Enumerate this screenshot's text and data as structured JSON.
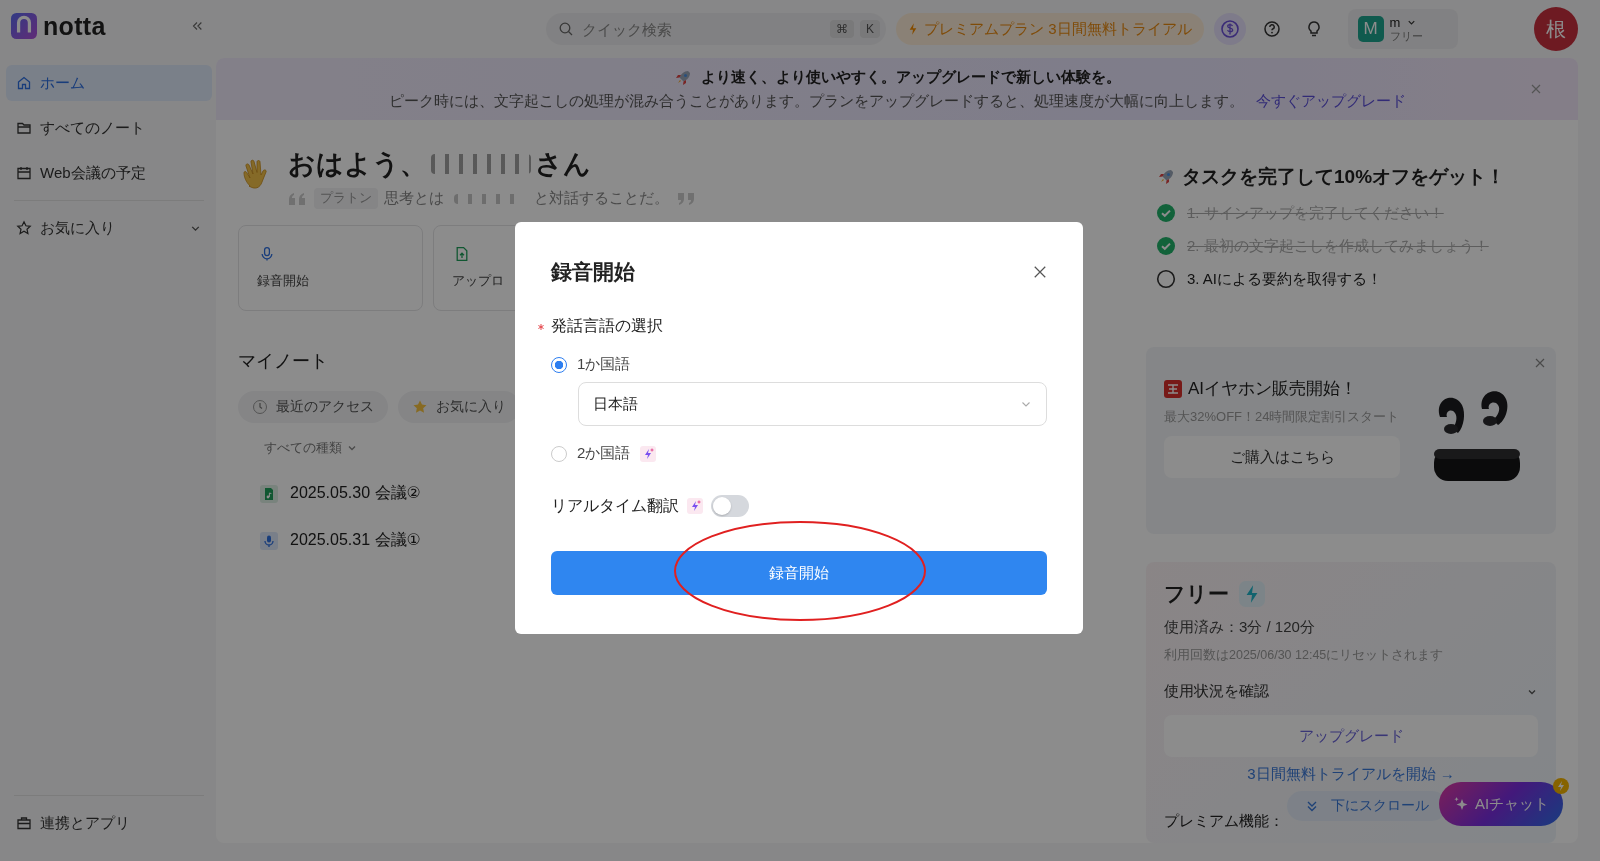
{
  "sidebar": {
    "logo": "notta",
    "items": [
      {
        "label": "ホーム",
        "kind": "home",
        "selected": true
      },
      {
        "label": "すべてのノート",
        "kind": "folder",
        "selected": false
      },
      {
        "label": "Web会議の予定",
        "kind": "calendar",
        "selected": false
      }
    ],
    "favorites": {
      "label": "お気に入り",
      "expanded": false
    },
    "bottom_item": "連携とアプリ"
  },
  "topbar": {
    "search": {
      "placeholder": "クイック検索",
      "keys": [
        "⌘",
        "K"
      ]
    },
    "premium_button": "プレミアムプラン 3日間無料トライアル",
    "account": {
      "avatar": "M",
      "name": "m",
      "plan": "フリー"
    },
    "user_avatar": "根"
  },
  "banner": {
    "headline": "より速く、より使いやすく。アップグレードで新しい体験を。",
    "message": "ピーク時には、文字起こしの処理が混み合うことがあります。プランをアップグレードすると、処理速度が大幅に向上します。",
    "link": "今すぐアップグレード"
  },
  "greeting": {
    "text": "おはよう、",
    "suffix": "さん",
    "quote_author": "プラトン",
    "quote_start": "思考とは",
    "quote_end": "と対話することだ。"
  },
  "actions": [
    {
      "label": "録音開始",
      "kind": "record"
    },
    {
      "label": "アップロ",
      "kind": "upload"
    }
  ],
  "notes": {
    "title": "マイノート",
    "filters": [
      {
        "label": "最近のアクセス",
        "kind": "recent"
      },
      {
        "label": "お気に入り",
        "kind": "favorite"
      }
    ],
    "type_filter": "すべての種類",
    "items": [
      {
        "title": "2025.05.30 会議②",
        "kind": "audio"
      },
      {
        "title": "2025.05.31 会議①",
        "kind": "recording"
      }
    ]
  },
  "tasks": {
    "title": "タスクを完了して10%オフをゲット！",
    "items": [
      {
        "label": "1. サインアップを完了してください！",
        "done": true
      },
      {
        "label": "2. 最初の文字起こしを作成してみましょう！",
        "done": true
      },
      {
        "label": "3. AIによる要約を取得する！",
        "done": false
      }
    ]
  },
  "promo": {
    "title": "AIイヤホン販売開始！",
    "subtitle": "最大32%OFF！24時間限定割引スタート",
    "button": "ご購入はこちら"
  },
  "plan": {
    "name": "フリー",
    "usage": "使用済み：3分 / 120分",
    "reset": "利用回数は2025/06/30 12:45にリセットされます",
    "details": "使用状況を確認",
    "upgrade": "アップグレード",
    "trial_link": "3日間無料トライアルを開始 →",
    "features_title": "プレミアム機能："
  },
  "floating": {
    "scroll": "下にスクロール",
    "chat": "AIチャット"
  },
  "modal": {
    "title": "録音開始",
    "field": {
      "label": "発話言語の選択",
      "required": true
    },
    "options": [
      {
        "label": "1か国語",
        "selected": true,
        "badge": false
      },
      {
        "label": "2か国語",
        "selected": false,
        "badge": true
      }
    ],
    "language": "日本語",
    "translation": {
      "label": "リアルタイム翻訳",
      "on": false,
      "badge": true
    },
    "start_button": "録音開始"
  },
  "annotation": {
    "kind": "ellipse",
    "color": "#e02020"
  }
}
